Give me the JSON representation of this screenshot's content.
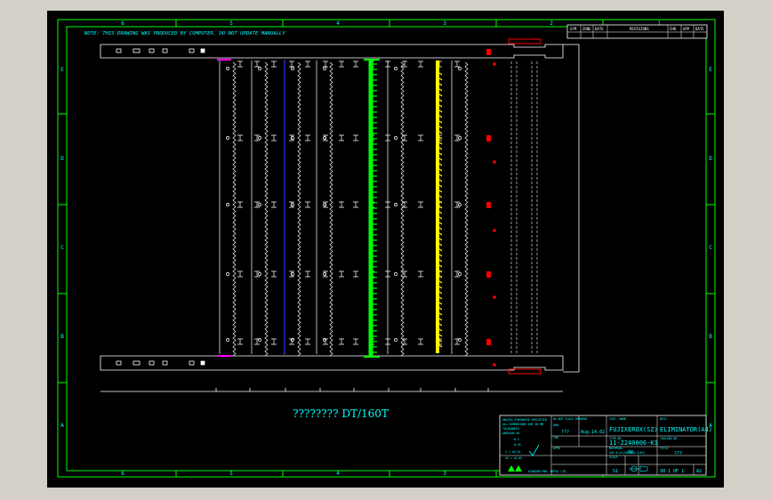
{
  "drawing": {
    "note": "NOTE: THIS DRAWING WAS PRODUCED BY COMPUTER. DO NOT UPDATE MANUALLY",
    "caption": "???????? DT/160T",
    "zone_columns_top": [
      "6",
      "5",
      "4",
      "3",
      "2",
      "1"
    ],
    "zone_columns_bottom": [
      "6",
      "5",
      "4",
      "3",
      "2",
      "1"
    ],
    "zone_rows_left": [
      "E",
      "D",
      "C",
      "B",
      "A"
    ],
    "zone_rows_right": [
      "E",
      "D",
      "C",
      "B",
      "A"
    ],
    "revision_headers": [
      "SYM",
      "ZONE",
      "DATE",
      "REVISIONS",
      "CHK",
      "APP",
      "DATE"
    ],
    "title_block": {
      "notes_lines": [
        "UNLESS OTHERWISE SPECIFIED",
        "ALL DIMENSIONS ARE IN MM",
        "TOLERANCES",
        "ANGULAR ±0",
        "0.X",
        "0.XX"
      ],
      "tol_values": [
        "X = ±0.15",
        "XX = ±0.05"
      ],
      "do_not_scale": "DO NOT SCALE DRAWING",
      "drn_label": "DRN",
      "drn_value": "???",
      "drn_date": "Aug.14.02",
      "chk_label": "CHK",
      "app_label": "APPD",
      "cust_label": "CUST. NAME",
      "cust_value": "FUJIXEROX(SZ)",
      "desc_label": "DESC.",
      "desc_value": "ELIMINATOR(A4)",
      "item_label": "ITEM NO.",
      "item_value": "11-2240006-K1",
      "tooling_label": "TOOLING NO.",
      "material_label": "MATERIAL",
      "material_value": "SUS 0.4t(SUS304-3/4H)",
      "temper": "PP",
      "title_label": "TITLE",
      "title_value": "???",
      "scale_label": "SCALE",
      "scale_value": "S1",
      "sheet": "SH 1 OF 1",
      "size": "A2",
      "company": "KINGDOM PWR. METAL LTD."
    }
  },
  "colors": {
    "background": "#000000",
    "border": "#00ff00",
    "text": "#00ffff",
    "part_outline": "#ffffff",
    "highlight_green": "#00ff00",
    "highlight_yellow": "#ffff00",
    "marker_red": "#ff0000",
    "accent_magenta": "#ff00ff",
    "blue_line": "#3030ff"
  }
}
